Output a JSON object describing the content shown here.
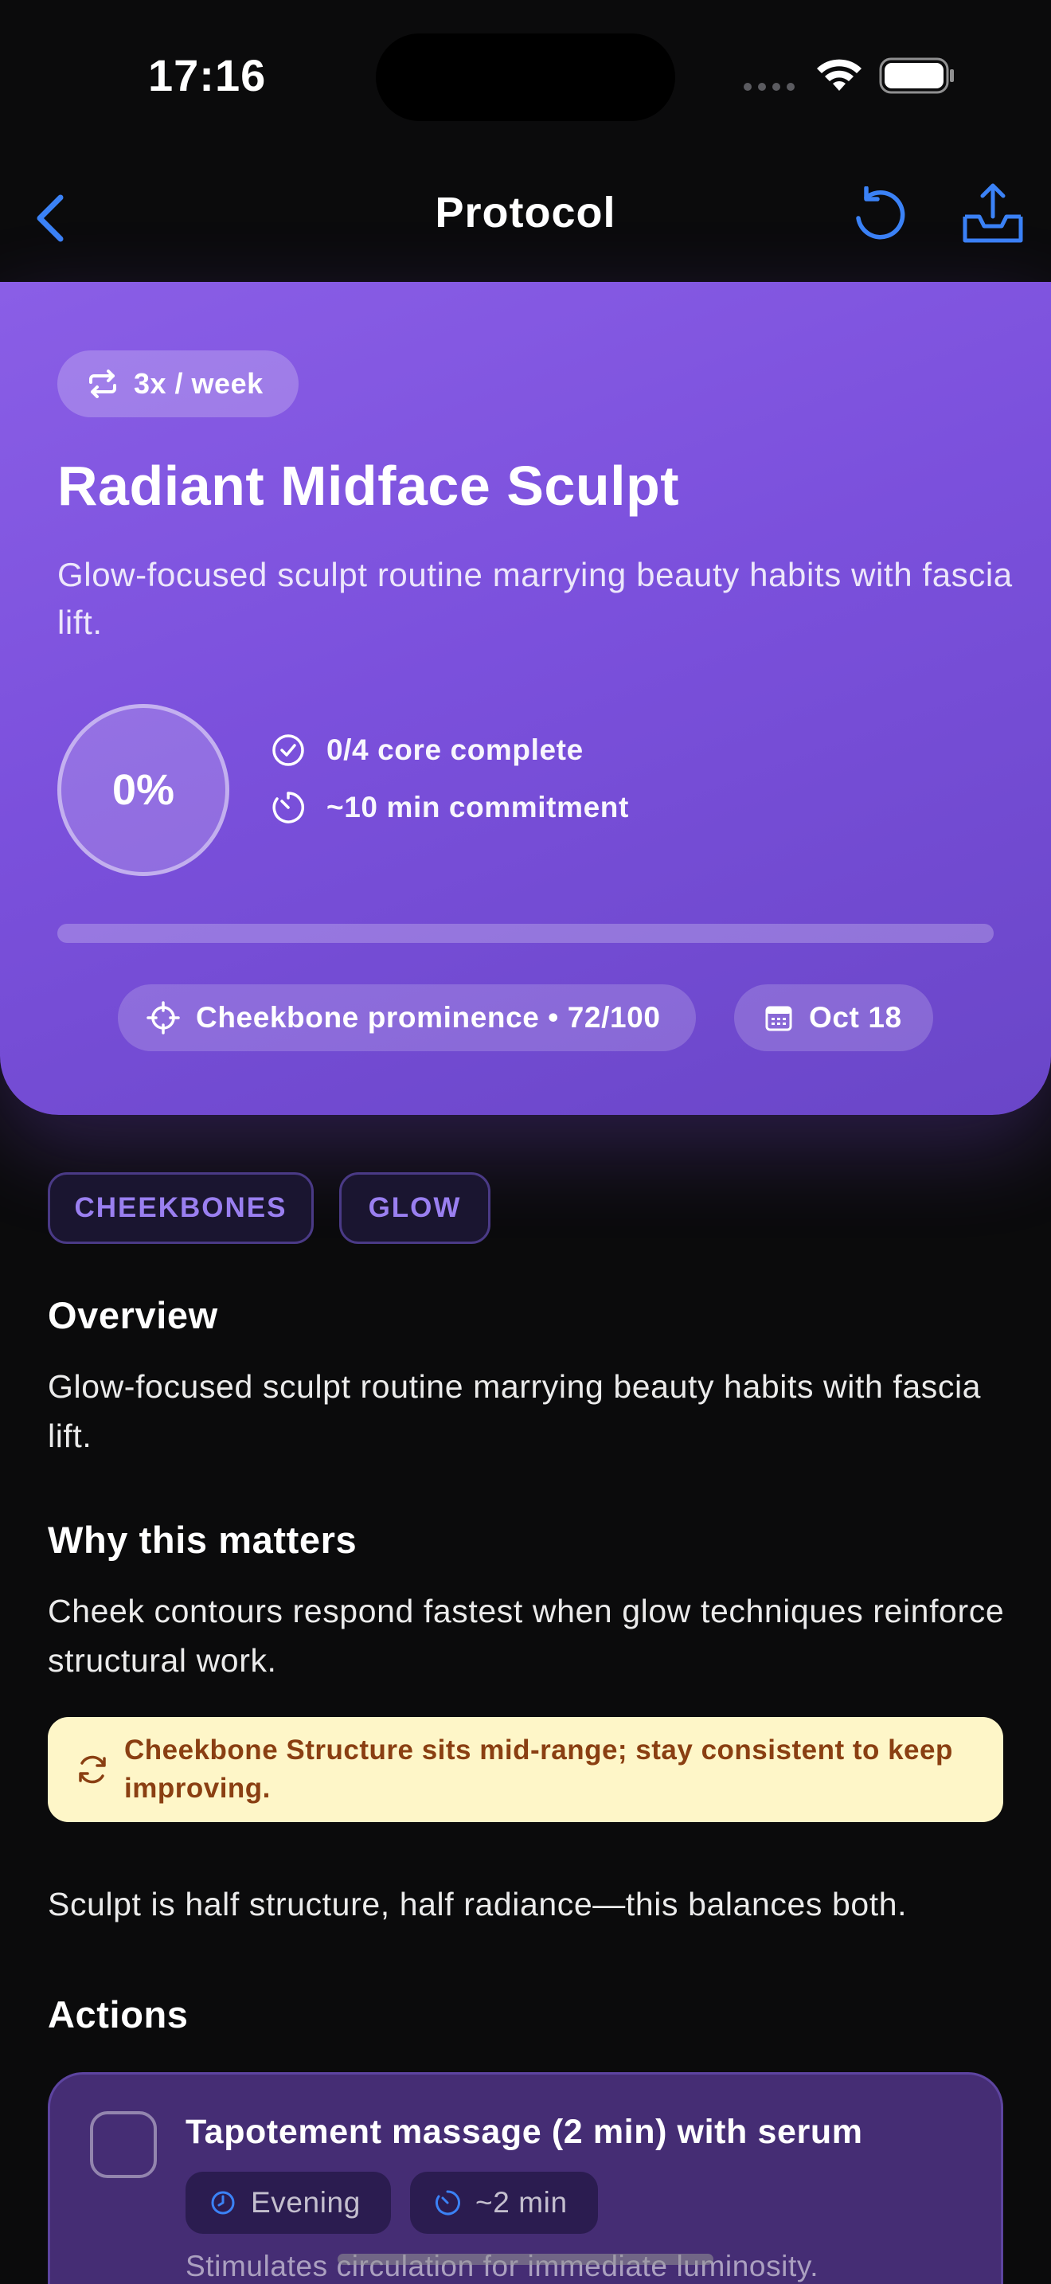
{
  "status_bar": {
    "time": "17:16",
    "icons": [
      "cellular-dots-icon",
      "wifi-icon",
      "battery-icon"
    ]
  },
  "nav": {
    "title": "Protocol",
    "back_icon": "chevron-left-icon",
    "reset_icon": "rotate-ccw-icon",
    "share_icon": "share-tray-icon",
    "accent_color": "#3b82f6"
  },
  "hero": {
    "frequency": "3x / week",
    "title": "Radiant Midface Sculpt",
    "description": "Glow-focused sculpt routine marrying beauty habits with fascia lift.",
    "progress_label": "0%",
    "progress_value": 0,
    "core_complete": "0/4 core complete",
    "commitment": "~10 min commitment",
    "metric": "Cheekbone prominence • 72/100",
    "date": "Oct 18",
    "gradient_colors": [
      "#8a5ee6",
      "#6a46c8"
    ]
  },
  "tags": [
    "CHEEKBONES",
    "GLOW"
  ],
  "overview": {
    "heading": "Overview",
    "text": "Glow-focused sculpt routine marrying beauty habits with fascia lift."
  },
  "why": {
    "heading": "Why this matters",
    "text": "Cheek contours respond fastest when glow techniques reinforce structural work.",
    "notice": "Cheekbone Structure sits mid-range; stay consistent to keep improving.",
    "notice_color": "#fef6c8",
    "footer": "Sculpt is half structure, half radiance—this balances both."
  },
  "actions": {
    "heading": "Actions",
    "items": [
      {
        "title": "Tapotement massage (2 min) with serum",
        "time_of_day": "Evening",
        "duration": "~2 min",
        "description": "Stimulates circulation for immediate luminosity.",
        "completed": false
      }
    ]
  }
}
